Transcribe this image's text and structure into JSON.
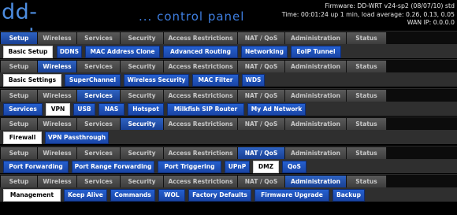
{
  "brand": {
    "logo": "dd-wrt.com",
    "tagline": "... control panel"
  },
  "status": {
    "firmware": "Firmware: DD-WRT v24-sp2 (08/07/10) std",
    "time": "Time: 00:01:24 up 1 min, load average: 0.26, 0.13, 0.05",
    "wan": "WAN IP: 0.0.0.0"
  },
  "main_tabs": [
    "Setup",
    "Wireless",
    "Services",
    "Security",
    "Access Restrictions",
    "NAT / QoS",
    "Administration",
    "Status"
  ],
  "sections": [
    {
      "active_tab": "Setup",
      "subtabs": [
        "Basic Setup",
        "DDNS",
        "MAC Address Clone",
        "Advanced Routing",
        "Networking",
        "EoIP Tunnel"
      ],
      "active_sub": "Basic Setup"
    },
    {
      "active_tab": "Wireless",
      "subtabs": [
        "Basic Settings",
        "SuperChannel",
        "Wireless Security",
        "MAC Filter",
        "WDS"
      ],
      "active_sub": "Basic Settings"
    },
    {
      "active_tab": "Services",
      "subtabs": [
        "Services",
        "VPN",
        "USB",
        "NAS",
        "Hotspot",
        "Milkfish SIP Router",
        "My Ad Network"
      ],
      "active_sub": "VPN"
    },
    {
      "active_tab": "Security",
      "subtabs": [
        "Firewall",
        "VPN Passthrough"
      ],
      "active_sub": "Firewall"
    },
    {
      "active_tab": "NAT / QoS",
      "subtabs": [
        "Port Forwarding",
        "Port Range Forwarding",
        "Port Triggering",
        "UPnP",
        "DMZ",
        "QoS"
      ],
      "active_sub": "DMZ"
    },
    {
      "active_tab": "Administration",
      "subtabs": [
        "Management",
        "Keep Alive",
        "Commands",
        "WOL",
        "Factory Defaults",
        "Firmware Upgrade",
        "Backup"
      ],
      "active_sub": "Management"
    }
  ]
}
